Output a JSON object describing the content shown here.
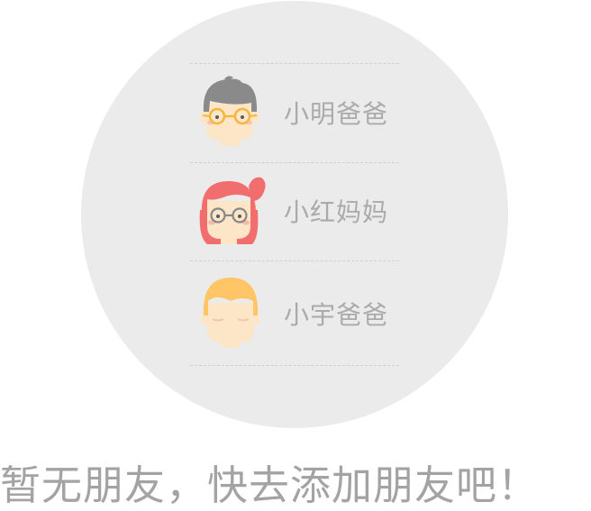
{
  "contacts": [
    {
      "name": "小明爸爸",
      "icon": "boy-glasses-avatar-icon"
    },
    {
      "name": "小红妈妈",
      "icon": "girl-ponytail-avatar-icon"
    },
    {
      "name": "小宇爸爸",
      "icon": "blond-boy-avatar-icon"
    }
  ],
  "empty_state": {
    "message": "暂无朋友，快去添加朋友吧！"
  },
  "colors": {
    "circle_bg": "#ebebeb",
    "text_gray": "#aaaaaa",
    "divider": "#cfcfcf",
    "skin": "#fde5c8",
    "hair_gray": "#8a8a8a",
    "hair_red": "#f26d6d",
    "hair_blond": "#ffc567",
    "glasses_gold": "#f4b73d",
    "glasses_gray": "#888888"
  }
}
